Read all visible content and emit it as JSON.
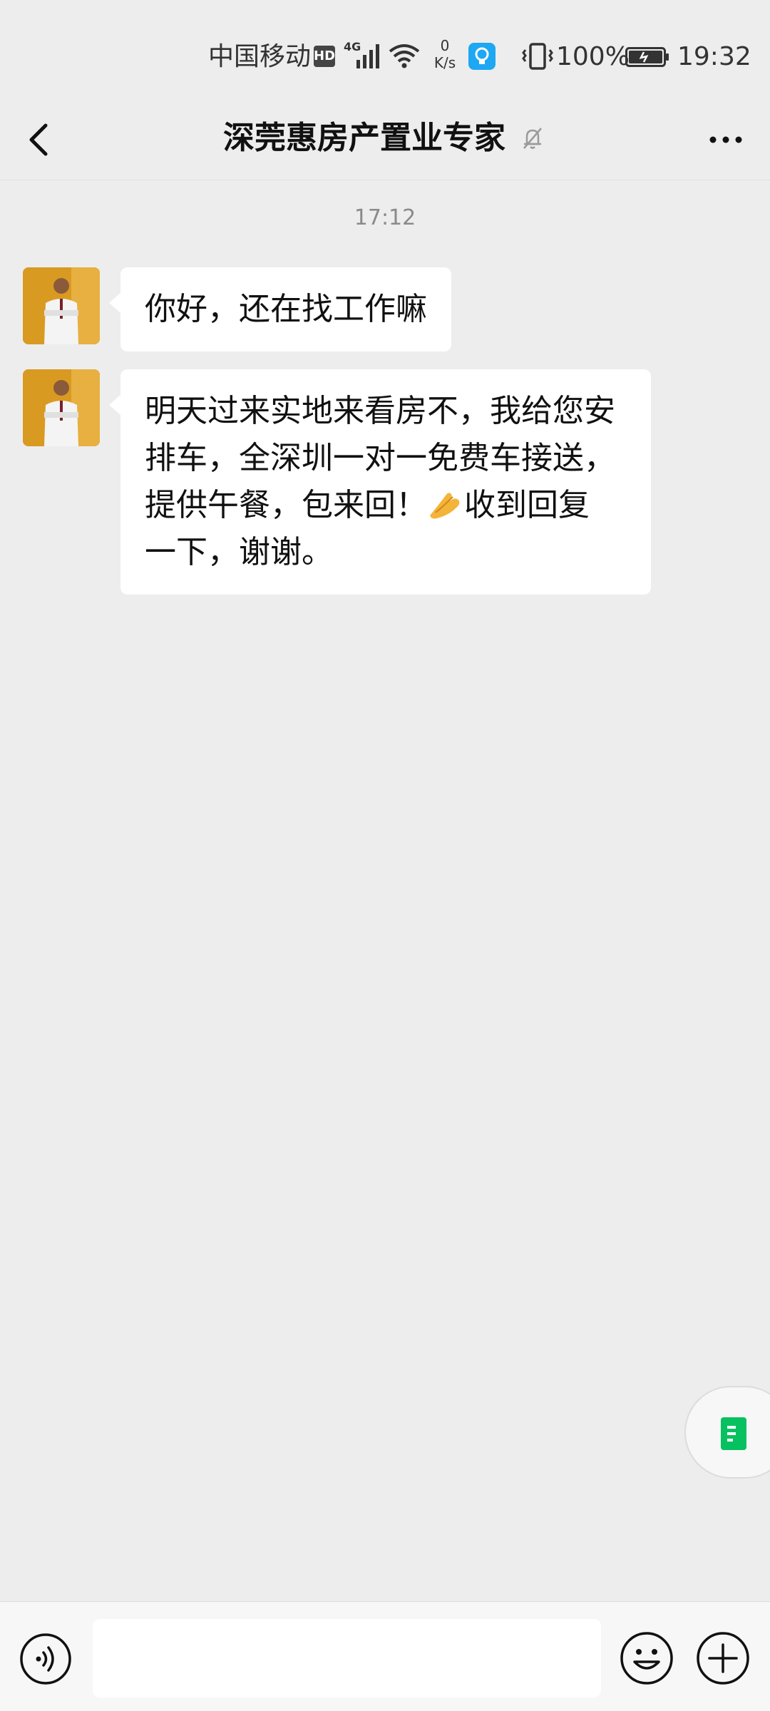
{
  "status_bar": {
    "carrier": "中国移动",
    "hd_badge": "HD",
    "network": "4G",
    "speed_value": "0",
    "speed_unit": "K/s",
    "battery": "100%",
    "time": "19:32",
    "icons": [
      "signal-icon",
      "wifi-icon",
      "bulb-icon",
      "vibrate-icon",
      "battery-icon"
    ]
  },
  "header": {
    "title": "深莞惠房产置业专家",
    "back_icon": "chevron-left-icon",
    "mute_icon": "bell-muted-icon",
    "more_icon": "ellipsis-icon"
  },
  "chat": {
    "timestamp": "17:12",
    "messages": [
      {
        "sender": "other",
        "text": "你好，还在找工作嘛"
      },
      {
        "sender": "other",
        "lines": [
          "明天过来实地来看房不，我给您安",
          "排车，全深圳一对一免费车接送，",
          "提供午餐，包来回！",
          "收到回复",
          "一下，谢谢。"
        ],
        "emoji": "pinched-fingers-emoji"
      }
    ]
  },
  "floating": {
    "icon": "document-icon",
    "color": "#07c160"
  },
  "input_bar": {
    "placeholder": "",
    "voice_icon": "voice-icon",
    "emoji_icon": "smiley-icon",
    "plus_icon": "plus-circle-icon"
  },
  "colors": {
    "background": "#ededed",
    "bubble": "#ffffff",
    "accent": "#07c160"
  }
}
